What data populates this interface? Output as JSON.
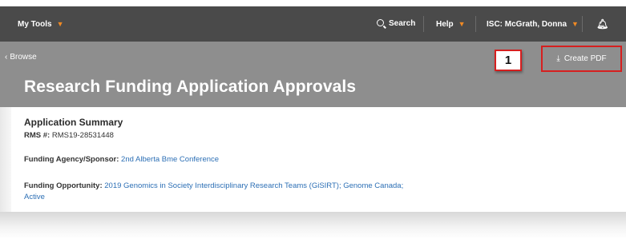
{
  "nav": {
    "my_tools": "My Tools",
    "search": "Search",
    "help": "Help",
    "user": "ISC: McGrath, Donna"
  },
  "header": {
    "breadcrumb": "Browse",
    "title": "Research Funding Application Approvals",
    "create_pdf": "Create PDF",
    "callout_number": "1"
  },
  "summary": {
    "heading": "Application Summary",
    "rms_label": "RMS #:",
    "rms_value": "RMS19-28531448",
    "agency_label": "Funding Agency/Sponsor:",
    "agency_value": "2nd Alberta Bme Conference",
    "opportunity_label": "Funding Opportunity:",
    "opportunity_value": "2019 Genomics in Society Interdisciplinary Research Teams (GiSIRT); Genome Canada; Active"
  },
  "colors": {
    "topbar": "#4a4a4a",
    "band": "#8e8e8e",
    "accent": "#f08a24",
    "highlight": "#d61f1f",
    "link": "#2c6fb5"
  },
  "icons": [
    "chevron-down-icon",
    "search-icon",
    "bell-icon",
    "download-icon",
    "chevron-left-icon"
  ]
}
